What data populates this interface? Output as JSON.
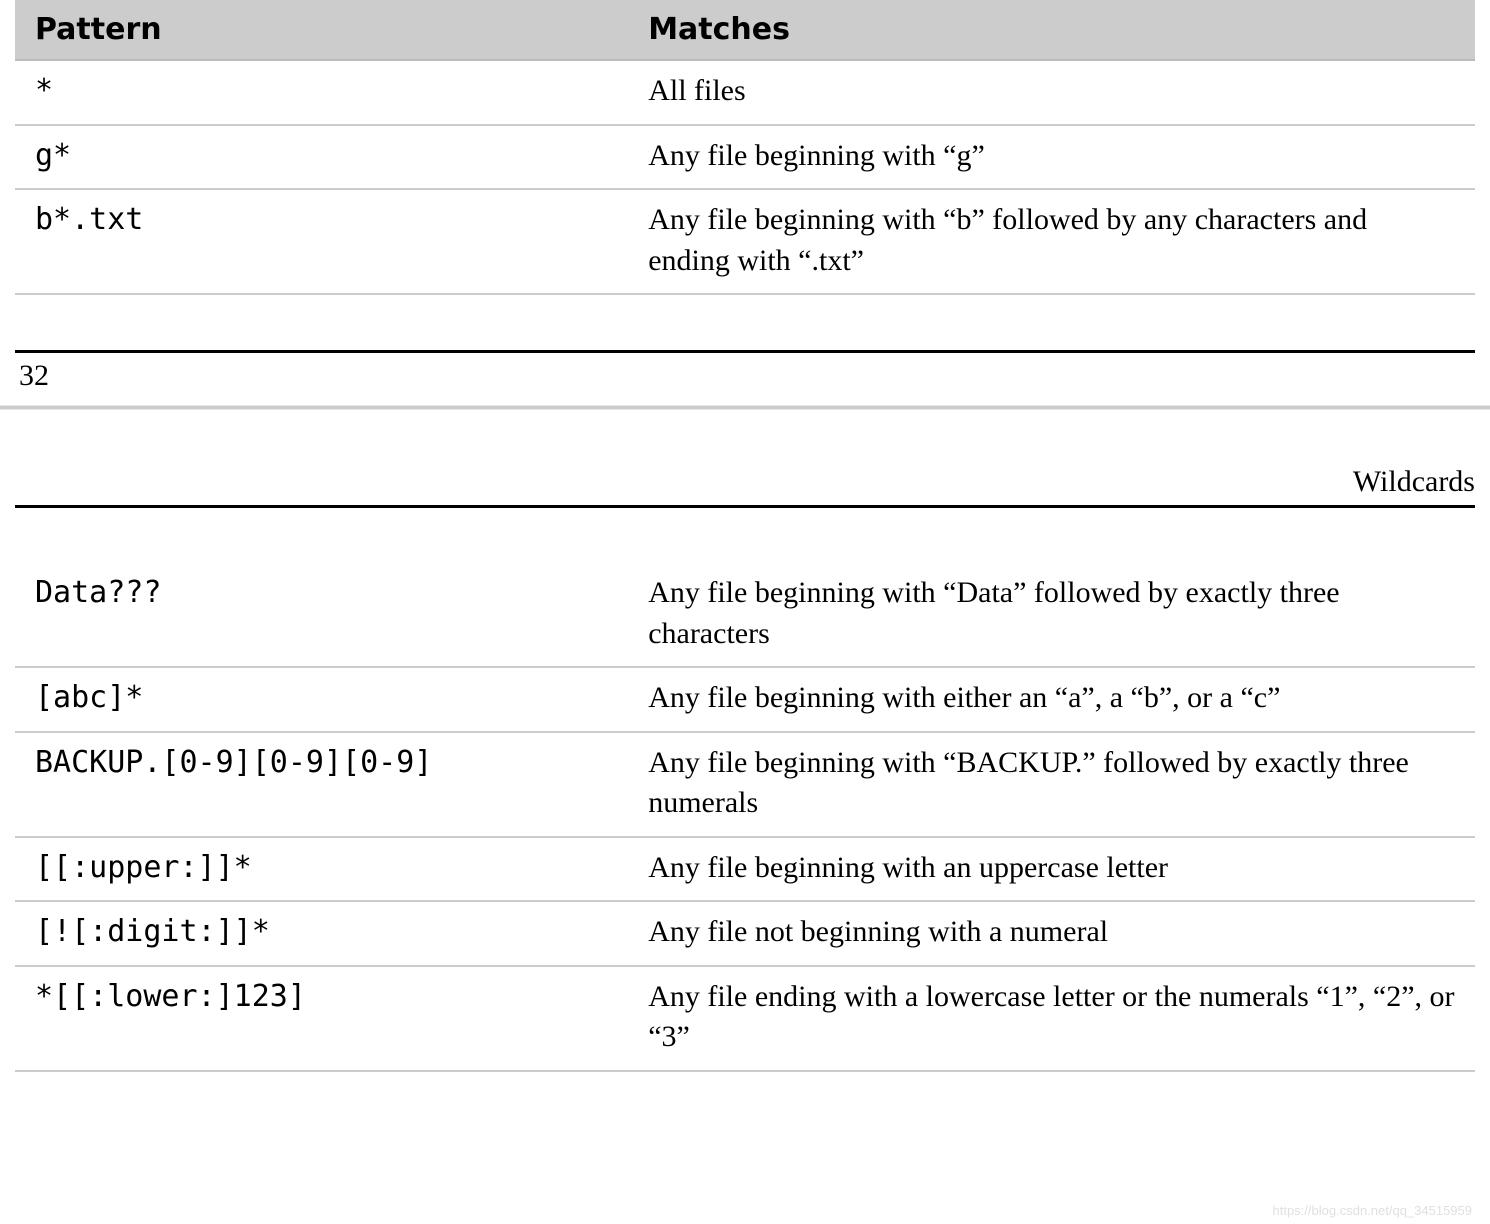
{
  "table1": {
    "headers": {
      "pattern": "Pattern",
      "matches": "Matches"
    },
    "rows": [
      {
        "pattern": "*",
        "matches": "All files"
      },
      {
        "pattern": "g*",
        "matches": "Any file beginning with “g”"
      },
      {
        "pattern": "b*.txt",
        "matches": "Any file beginning with “b” followed by any characters and ending with “.txt”"
      }
    ]
  },
  "page_number": "32",
  "running_head": "Wildcards",
  "table2": {
    "rows": [
      {
        "pattern": "Data???",
        "matches": "Any file beginning with “Data” followed by exactly three characters"
      },
      {
        "pattern": "[abc]*",
        "matches": "Any file beginning with either an “a”, a “b”, or a “c”"
      },
      {
        "pattern": "BACKUP.[0-9][0-9][0-9]",
        "matches": "Any file beginning with “BACKUP.” followed by exactly three numerals"
      },
      {
        "pattern": "[[:upper:]]*",
        "matches": "Any file beginning with an uppercase letter"
      },
      {
        "pattern": "[![:digit:]]*",
        "matches": "Any file not beginning with a numeral"
      },
      {
        "pattern": "*[[:lower:]123]",
        "matches": "Any file ending with a lowercase letter or the numerals “1”, “2”, or “3”"
      }
    ]
  },
  "watermark": "https://blog.csdn.net/qq_34515959"
}
